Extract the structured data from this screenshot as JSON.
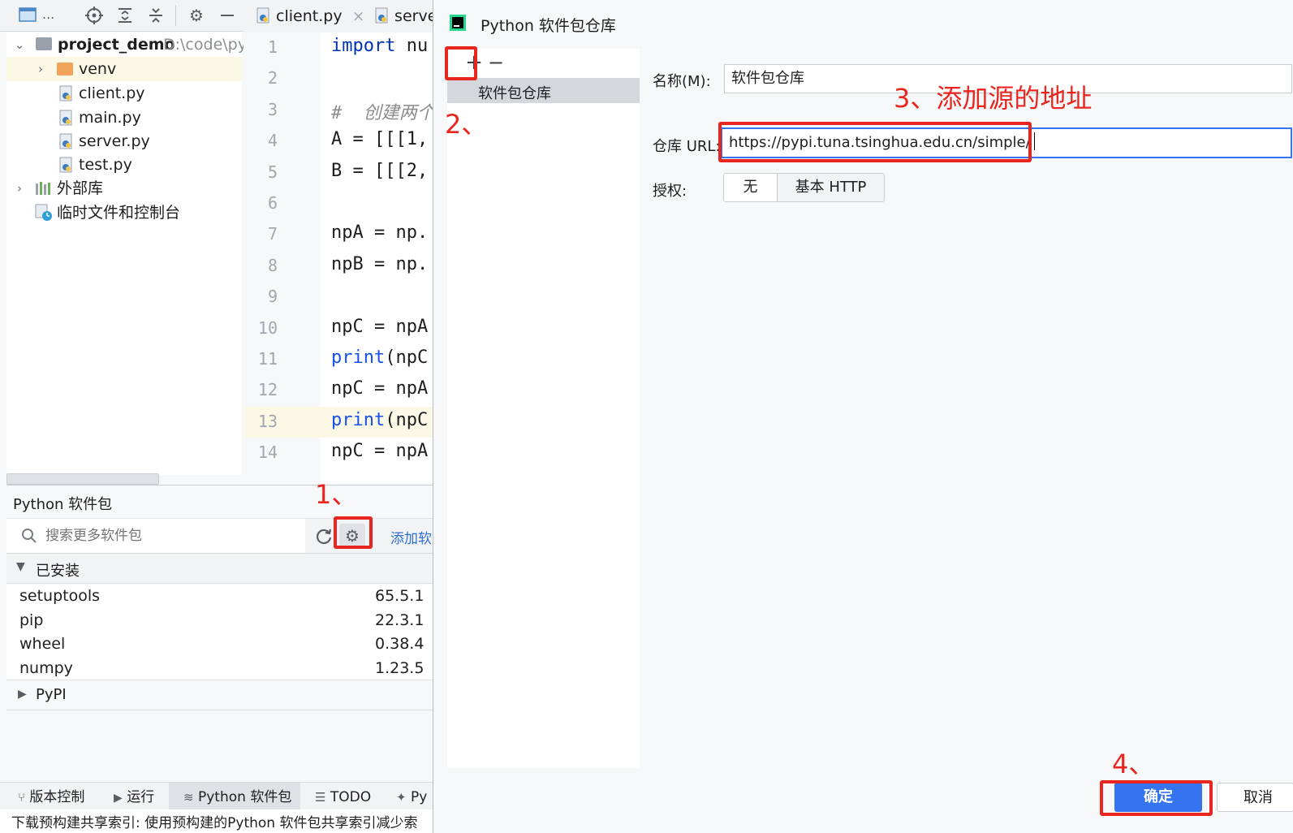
{
  "ide": {
    "project_toolbar_label": "...",
    "project": {
      "root_name": "project_demo",
      "root_path": "D:\\code\\pyt",
      "items": [
        "venv",
        "client.py",
        "main.py",
        "server.py",
        "test.py"
      ],
      "external_libs": "外部库",
      "scratches": "临时文件和控制台"
    },
    "editor": {
      "tabs": [
        "client.py",
        "serve"
      ],
      "line_numbers": [
        "1",
        "2",
        "3",
        "4",
        "5",
        "6",
        "7",
        "8",
        "9",
        "10",
        "11",
        "12",
        "13",
        "14"
      ],
      "lines": [
        {
          "kw": "import",
          "rest": " nu"
        },
        {
          "kw": "",
          "rest": ""
        },
        {
          "comment": "#  创建两个"
        },
        {
          "kw": "",
          "rest": "A = [[[1,"
        },
        {
          "kw": "",
          "rest": "B = [[[2,"
        },
        {
          "kw": "",
          "rest": ""
        },
        {
          "kw": "",
          "rest": "npA = np."
        },
        {
          "kw": "",
          "rest": "npB = np."
        },
        {
          "kw": "",
          "rest": ""
        },
        {
          "kw": "",
          "rest": "npC = npA"
        },
        {
          "fn": "print",
          "rest": "(npC"
        },
        {
          "kw": "",
          "rest": "npC = npA"
        },
        {
          "fn": "print",
          "rest": "(npC"
        },
        {
          "kw": "",
          "rest": "npC = npA"
        }
      ]
    },
    "packages": {
      "title": "Python 软件包",
      "search_placeholder": "搜索更多软件包",
      "add_link": "添加软",
      "installed_label": "已安装",
      "installed": [
        {
          "name": "setuptools",
          "version": "65.5.1"
        },
        {
          "name": "pip",
          "version": "22.3.1"
        },
        {
          "name": "wheel",
          "version": "0.38.4"
        },
        {
          "name": "numpy",
          "version": "1.23.5"
        }
      ],
      "pypi_label": "PyPI"
    },
    "bottom_bar": [
      "版本控制",
      "运行",
      "Python 软件包",
      "TODO",
      "Py"
    ],
    "status_text": "下载预构建共享索引: 使用预构建的Python 软件包共享索引减少索"
  },
  "dialog": {
    "title": "Python 软件包仓库",
    "repo_list": [
      "软件包仓库"
    ],
    "name_label": "名称(M):",
    "name_value": "软件包仓库",
    "url_label": "仓库 URL:",
    "url_value": "https://pypi.tuna.tsinghua.edu.cn/simple/",
    "auth_label": "授权:",
    "auth_options": [
      "无",
      "基本 HTTP"
    ],
    "ok_label": "确定",
    "cancel_label": "取消"
  },
  "annotations": {
    "step1": "1、",
    "step2": "2、",
    "step3": "3、添加源的地址",
    "step4": "4、"
  },
  "colors": {
    "annotation_red": "#e8261f",
    "primary_button": "#3574f0",
    "keyword": "#0033b3"
  }
}
